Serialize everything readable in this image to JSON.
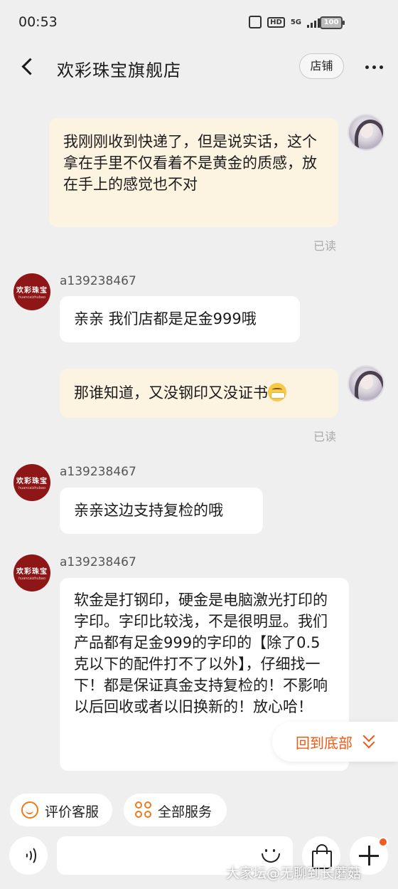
{
  "status_bar": {
    "time": "00:53",
    "network": "5G",
    "hd": "HD",
    "battery": "100"
  },
  "header": {
    "title": "欢彩珠宝旗舰店",
    "shop_button": "店铺"
  },
  "store_avatar": {
    "line1": "欢彩珠宝",
    "line2": "huancaizhubao"
  },
  "messages": [
    {
      "from": "me",
      "text": "我刚刚收到快递了，但是说实话，这个拿在手里不仅看着不是黄金的质感，放在手上的感觉也不对",
      "status": "已读"
    },
    {
      "from": "store",
      "sender": "a139238467",
      "text": "亲亲 我们店都是足金999哦"
    },
    {
      "from": "me",
      "text": "那谁知道，又没钢印又没证书",
      "emoji": "grinning-face-emoji",
      "status": "已读"
    },
    {
      "from": "store",
      "sender": "a139238467",
      "text": "亲亲这边支持复检的哦"
    },
    {
      "from": "store",
      "sender": "a139238467",
      "text": "软金是打钢印，硬金是电脑激光打印的字印。字印比较浅，不是很明显。我们产品都有足金999的字印的【除了0.5克以下的配件打不了以外】，仔细找一下！都是保证真金支持复检的！不影响以后回收或者以旧换新的！放心哈！"
    }
  ],
  "back_to_bottom": "回到底部",
  "chips": [
    {
      "label": "评价客服",
      "icon": "smile-icon"
    },
    {
      "label": "全部服务",
      "icon": "services-grid-icon"
    }
  ],
  "input": {
    "placeholder": ""
  },
  "watermark": "大家坛@无聊到长蘑菇",
  "colors": {
    "accent": "#ef5a14",
    "my_bubble": "#fdf3e1",
    "store_avatar": "#8e1616"
  }
}
